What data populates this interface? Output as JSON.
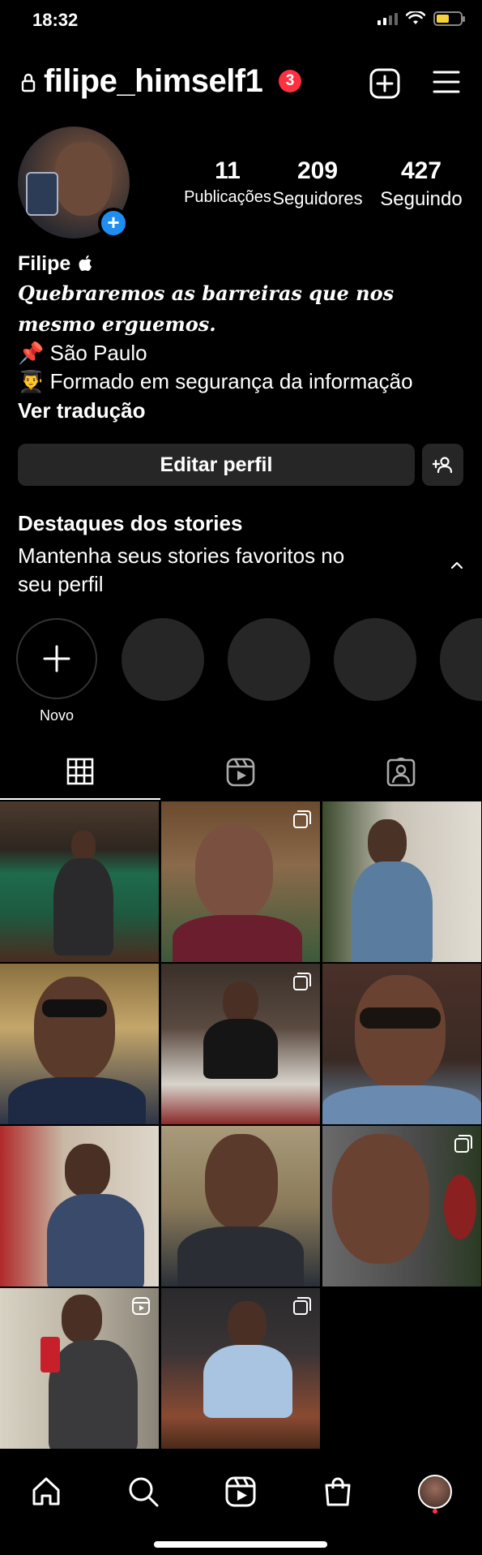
{
  "status_bar": {
    "time": "18:32",
    "battery_color": "#f5d13a"
  },
  "header": {
    "username": "filipe_himself1",
    "notification_count": "3"
  },
  "profile": {
    "stats": [
      {
        "value": "11",
        "label": "Publicações"
      },
      {
        "value": "209",
        "label": "Seguidores"
      },
      {
        "value": "427",
        "label": "Seguindo"
      }
    ]
  },
  "bio": {
    "name": "Filipe",
    "quote_line1": "Quebraremos as barreiras que nos",
    "quote_line2": "mesmo erguemos.",
    "location": "📌 São Paulo",
    "education": "👨‍🎓 Formado em segurança da informação",
    "translate": "Ver tradução"
  },
  "actions": {
    "edit_profile": "Editar perfil"
  },
  "highlights": {
    "title": "Destaques dos stories",
    "subtitle": "Mantenha seus stories favoritos no seu perfil",
    "new_label": "Novo"
  },
  "colors": {
    "accent": "#1f8ef1",
    "badge": "#ff3040",
    "button_bg": "#262626"
  },
  "icons": {
    "header": [
      "lock-icon",
      "new-post-icon",
      "menu-icon"
    ],
    "tabs": [
      "grid-icon",
      "reels-icon",
      "tagged-icon"
    ],
    "nav": [
      "home-icon",
      "search-icon",
      "reels-icon",
      "shop-icon",
      "profile-avatar"
    ]
  }
}
